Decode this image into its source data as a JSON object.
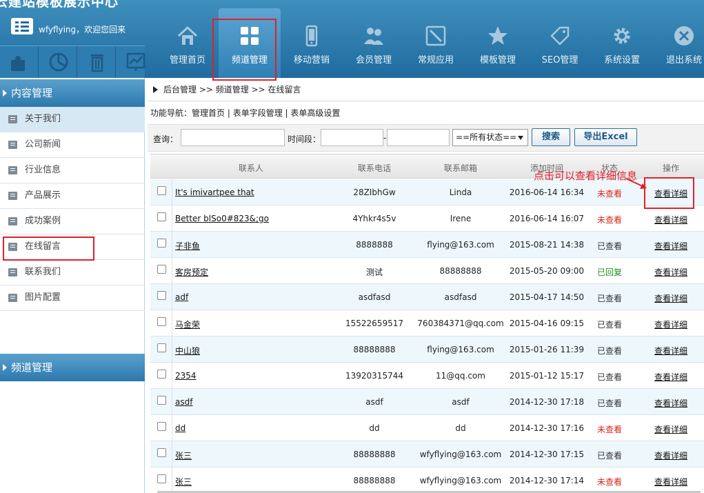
{
  "header": {
    "site_title": "云建站模板展示中心",
    "welcome": "wfyflying，欢迎您回来"
  },
  "toolbar": [
    {
      "icon": "puzzle-icon"
    },
    {
      "icon": "pie-chart-icon"
    },
    {
      "icon": "trash-icon"
    },
    {
      "icon": "line-chart-icon"
    }
  ],
  "nav": [
    {
      "label": "管理首页",
      "icon": "home-icon"
    },
    {
      "label": "频道管理",
      "icon": "grid-icon",
      "active": true
    },
    {
      "label": "移动营销",
      "icon": "phone-icon"
    },
    {
      "label": "会员管理",
      "icon": "users-icon"
    },
    {
      "label": "常规应用",
      "icon": "tools-icon"
    },
    {
      "label": "模板管理",
      "icon": "star-icon"
    },
    {
      "label": "SEO管理",
      "icon": "tag-icon"
    },
    {
      "label": "系统设置",
      "icon": "gear-icon"
    },
    {
      "label": "退出系统",
      "icon": "close-icon"
    }
  ],
  "sidebar": {
    "section1": "内容管理",
    "items": [
      "关于我们",
      "公司新闻",
      "行业信息",
      "产品展示",
      "成功案例",
      "在线留言",
      "联系我们",
      "图片配置"
    ],
    "section2": "频道管理"
  },
  "breadcrumb": "后台管理 >> 频道管理 >> 在线留言",
  "funcnav": {
    "prefix": "功能导航：",
    "links": [
      "管理首页",
      "表单字段管理",
      "表单高级设置"
    ],
    "sep": " | "
  },
  "filter": {
    "query_label": "查询：",
    "period_label": "时间段：",
    "dash": "-",
    "status_select": "==所有状态==",
    "search_btn": "搜索",
    "export_btn": "导出Excel"
  },
  "table": {
    "headers": [
      "联系人",
      "联系电话",
      "联系邮箱",
      "添加时间",
      "状态",
      "操作"
    ],
    "rows": [
      {
        "name": "It's imivartpee that",
        "phone": "28ZIbhGw",
        "email": "Linda",
        "time": "2016-06-14 16:34",
        "status": "未查看",
        "op": "查看详细"
      },
      {
        "name": "Better blSo0#823&;go",
        "phone": "4Yhkr4s5v",
        "email": "Irene",
        "time": "2016-06-14 16:07",
        "status": "未查看",
        "op": "查看详细"
      },
      {
        "name": "子非鱼",
        "phone": "8888888",
        "email": "flying@163.com",
        "time": "2015-08-21 14:38",
        "status": "已查看",
        "op": "查看详细"
      },
      {
        "name": "客房预定",
        "phone": "测试",
        "email": "88888888",
        "time": "2015-05-20 09:00",
        "status": "已回复",
        "op": "查看详细"
      },
      {
        "name": "adf",
        "phone": "asdfasd",
        "email": "asdfasd",
        "time": "2015-04-17 14:50",
        "status": "已查看",
        "op": "查看详细"
      },
      {
        "name": "马金荣",
        "phone": "15522659517",
        "email": "760384371@qq.com",
        "time": "2015-04-16 09:15",
        "status": "已查看",
        "op": "查看详细"
      },
      {
        "name": "中山狼",
        "phone": "88888888",
        "email": "flying@163.com",
        "time": "2015-01-26 11:39",
        "status": "已查看",
        "op": "查看详细"
      },
      {
        "name": "2354",
        "phone": "13920315744",
        "email": "11@qq.com",
        "time": "2015-01-12 15:17",
        "status": "已查看",
        "op": "查看详细"
      },
      {
        "name": "asdf",
        "phone": "asdf",
        "email": "asdf",
        "time": "2014-12-30 17:18",
        "status": "已查看",
        "op": "查看详细"
      },
      {
        "name": "dd",
        "phone": "dd",
        "email": "dd",
        "time": "2014-12-30 17:16",
        "status": "未查看",
        "op": "查看详细"
      },
      {
        "name": "张三",
        "phone": "88888888",
        "email": "wfyflying@163.com",
        "time": "2014-12-30 17:15",
        "status": "已查看",
        "op": "查看详细"
      },
      {
        "name": "张三",
        "phone": "88888888",
        "email": "wfyflying@163.com",
        "time": "2014-12-30 17:14",
        "status": "未查看",
        "op": "查看详细"
      }
    ]
  },
  "annotation": "点击可以查看详细信息",
  "colors": {
    "header": "#1f6b9e",
    "status_unread": "#d9261c",
    "status_replied": "#1f8f1f",
    "highlight": "#e0202a"
  }
}
